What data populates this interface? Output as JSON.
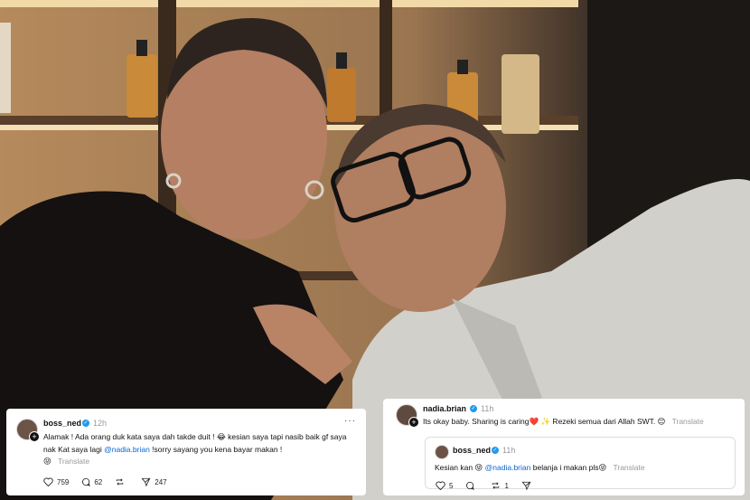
{
  "left_post": {
    "username": "boss_ned",
    "time": "12h",
    "text_before": "Alamak ! Ada orang duk kata saya dah takde duit ! ",
    "emoji1": "😂",
    "text_mid": " kesian saya tapi nasib baik gf saya nak Kat saya lagi ",
    "mention": "@nadia.brian",
    "text_after": " !sorry sayang you kena bayar makan !",
    "emoji2": "😝",
    "translate": "Translate",
    "likes": "759",
    "comments": "62",
    "shares": "247"
  },
  "right_post": {
    "username": "nadia.brian",
    "time": "11h",
    "text_before": "Its okay baby. Sharing is caring",
    "emoji_heart": "❤️",
    "emoji_sparkle": "✨",
    "text_after": " Rezeki semua dari Allah SWT. ",
    "emoji_smile": "😊",
    "translate": "Translate",
    "quote": {
      "username": "boss_ned",
      "time": "11h",
      "text_before": "Kesian kan ",
      "emoji": "😝",
      "mention": "@nadia.brian",
      "text_after": " belanja i makan pls",
      "emoji2": "😝",
      "translate": "Translate",
      "likes": "5",
      "reposts": "1"
    }
  },
  "colors": {
    "accent_link": "#0a66d6",
    "verified": "#1d9bf0",
    "heart": "#e0245e"
  }
}
